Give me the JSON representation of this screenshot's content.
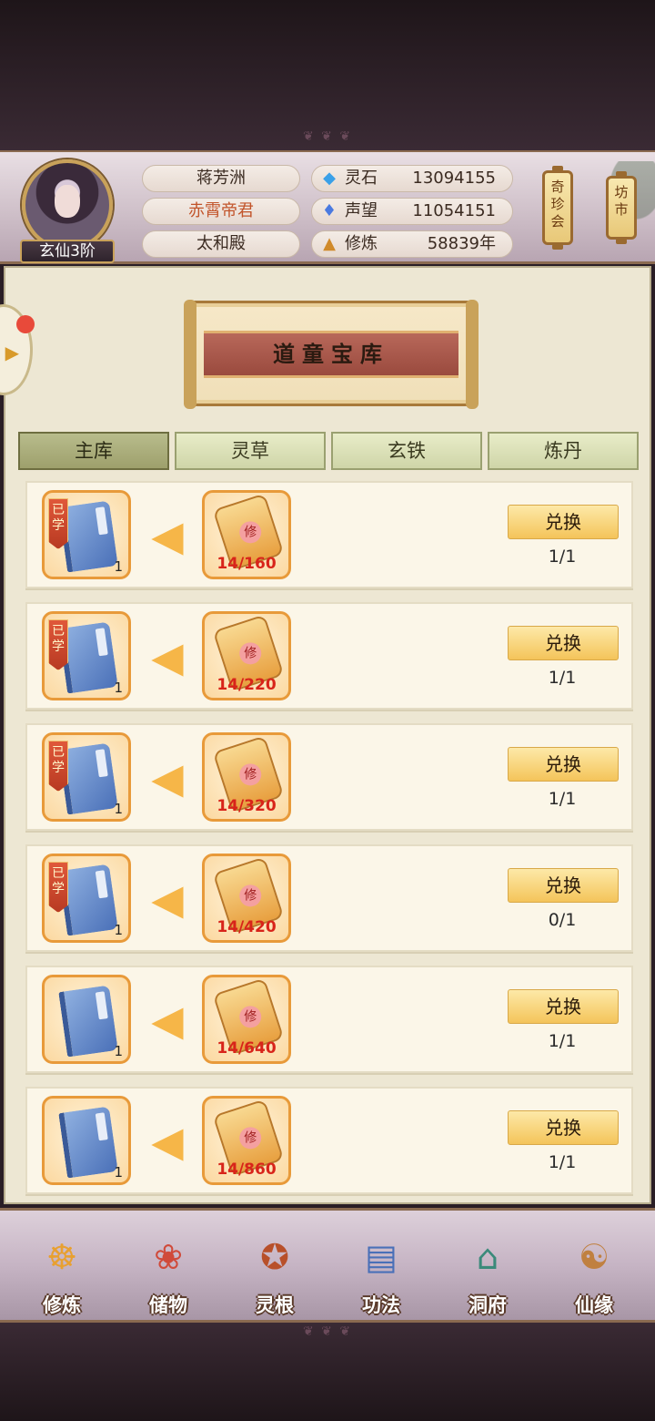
{
  "header": {
    "rank": "玄仙3阶",
    "info": [
      "蒋芳洲",
      "赤霄帝君",
      "太和殿"
    ],
    "resources": [
      {
        "label": "灵石",
        "value": "13094155",
        "icon": "spirit-stone-icon"
      },
      {
        "label": "声望",
        "value": "11054151",
        "icon": "prestige-icon"
      },
      {
        "label": "修炼",
        "value": "58839年",
        "icon": "cultivation-icon"
      }
    ],
    "lanterns": [
      "奇珍会",
      "坊市"
    ]
  },
  "panel": {
    "title": "道童宝库",
    "tabs": [
      "主库",
      "灵草",
      "玄铁",
      "炼丹"
    ],
    "active_tab": 0,
    "learned_tag": "已学",
    "exchange_label": "兑换",
    "seal_char": "修",
    "rows": [
      {
        "learned": true,
        "count": "1",
        "progress": "14/160",
        "limit": "1/1"
      },
      {
        "learned": true,
        "count": "1",
        "progress": "14/220",
        "limit": "1/1"
      },
      {
        "learned": true,
        "count": "1",
        "progress": "14/320",
        "limit": "1/1"
      },
      {
        "learned": true,
        "count": "1",
        "progress": "14/420",
        "limit": "0/1"
      },
      {
        "learned": false,
        "count": "1",
        "progress": "14/640",
        "limit": "1/1"
      },
      {
        "learned": false,
        "count": "1",
        "progress": "14/860",
        "limit": "1/1"
      }
    ]
  },
  "nav": [
    {
      "label": "修炼",
      "icon": "meditation-icon"
    },
    {
      "label": "储物",
      "icon": "bag-icon"
    },
    {
      "label": "灵根",
      "icon": "spirit-root-icon"
    },
    {
      "label": "功法",
      "icon": "book-icon"
    },
    {
      "label": "洞府",
      "icon": "cave-palace-icon"
    },
    {
      "label": "仙缘",
      "icon": "gourd-icon"
    }
  ]
}
